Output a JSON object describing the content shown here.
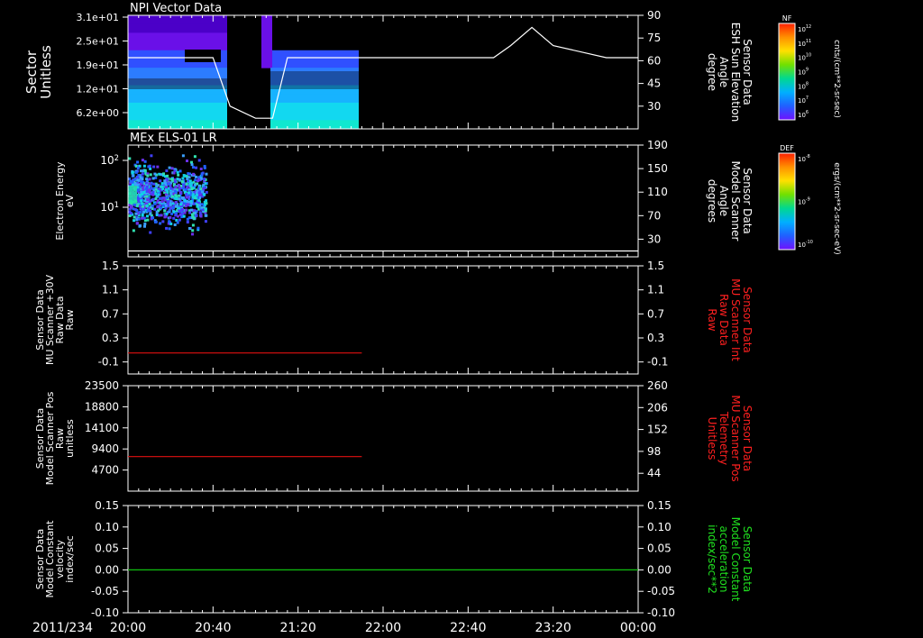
{
  "date_label": "2011/234",
  "x_ticks": [
    "20:00",
    "20:40",
    "21:20",
    "22:00",
    "22:40",
    "23:20",
    "00:00"
  ],
  "colorbars": [
    {
      "tag": "NF",
      "unit": "cnts/(cm**2-sr-sec)",
      "ticks": [
        "10^12",
        "10^11",
        "10^10",
        "10^9",
        "10^8",
        "10^7",
        "10^6"
      ]
    },
    {
      "tag": "DEF",
      "unit": "ergs/(cm**2-sr-sec-eV)",
      "ticks": [
        "10^-8",
        "10^-9",
        "10^-10"
      ]
    }
  ],
  "chart_data": [
    {
      "type": "heatmap",
      "title": "NPI Vector Data",
      "ylabel": [
        "Sector",
        "Unitless"
      ],
      "y_ticks": [
        "3.1e+01",
        "2.5e+01",
        "1.9e+01",
        "1.2e+01",
        "6.2e+00"
      ],
      "right_ylabel": [
        "Sensor Data",
        "ESH Sun Elevation",
        "Angle",
        "degree"
      ],
      "right_ylabel_color": "#ffffff",
      "right_y_ticks": [
        "90",
        "75",
        "60",
        "45",
        "30"
      ],
      "right_ylim": [
        15,
        90
      ],
      "series": [
        {
          "color": "#ffffff",
          "x_min": [
            0,
            20,
            40,
            48,
            60,
            68,
            75,
            90,
            150,
            172,
            180,
            190,
            200,
            225,
            235,
            240
          ],
          "y": [
            62,
            62,
            62,
            30,
            22,
            22,
            62,
            62,
            62,
            62,
            70,
            82,
            70,
            62,
            62,
            62
          ]
        }
      ]
    },
    {
      "type": "heatmap",
      "title": "MEx ELS-01 LR",
      "ylabel": [
        "Electron Energy",
        "eV"
      ],
      "y_ticks": [
        "10^2",
        "10^1"
      ],
      "right_ylabel": [
        "Sensor Data",
        "Model Scanner",
        "Angle",
        "degrees"
      ],
      "right_ylabel_color": "#ffffff",
      "right_y_ticks": [
        "190",
        "150",
        "110",
        "70",
        "30"
      ],
      "right_ylim": [
        0,
        190
      ],
      "series": [
        {
          "color": "#ffffff",
          "x_min": [
            0,
            240
          ],
          "y": [
            10,
            10
          ]
        }
      ]
    },
    {
      "type": "line",
      "title": "",
      "ylabel": [
        "Sensor Data",
        "MU Scanner +30V",
        "Raw Data",
        "Raw"
      ],
      "y_ticks": [
        "1.5",
        "1.1",
        "0.7",
        "0.3",
        "-0.1"
      ],
      "ylim": [
        -0.3,
        1.5
      ],
      "right_ylabel": [
        "Sensor Data",
        "MU Scanner Int",
        "Raw Data",
        "Raw"
      ],
      "right_ylabel_color": "#ff2020",
      "right_y_ticks": [
        "1.5",
        "1.1",
        "0.7",
        "0.3",
        "-0.1"
      ],
      "right_ylim": [
        -0.3,
        1.5
      ],
      "series": [
        {
          "color": "#e01010",
          "x_min": [
            0,
            110
          ],
          "y": [
            0.05,
            0.05
          ]
        }
      ]
    },
    {
      "type": "line",
      "title": "",
      "ylabel": [
        "Sensor Data",
        "Model Scanner Pos",
        "Raw",
        "unitless"
      ],
      "y_ticks": [
        "23500",
        "18800",
        "14100",
        "9400",
        "4700"
      ],
      "ylim": [
        0,
        23500
      ],
      "right_ylabel": [
        "Sensor Data",
        "MU Scanner Pos",
        "Telemetry",
        "Unitless"
      ],
      "right_ylabel_color": "#ff2020",
      "right_y_ticks": [
        "260",
        "206",
        "152",
        "98",
        "44"
      ],
      "right_ylim": [
        0,
        260
      ],
      "series": [
        {
          "color": "#e01010",
          "x_min": [
            0,
            110
          ],
          "y": [
            7700,
            7700
          ]
        }
      ]
    },
    {
      "type": "line",
      "title": "",
      "ylabel": [
        "Sensor Data",
        "Model Constant",
        "velocity",
        "index/sec"
      ],
      "y_ticks": [
        "0.15",
        "0.10",
        "0.05",
        "0.00",
        "-0.05",
        "-0.10"
      ],
      "ylim": [
        -0.1,
        0.15
      ],
      "right_ylabel": [
        "Sensor Data",
        "Model Constant",
        "acceleration",
        "index/sec**2"
      ],
      "right_ylabel_color": "#20e020",
      "right_y_ticks": [
        "0.15",
        "0.10",
        "0.05",
        "0.00",
        "-0.05",
        "-0.10"
      ],
      "right_ylim": [
        -0.1,
        0.15
      ],
      "series": [
        {
          "color": "#10c010",
          "x_min": [
            0,
            240
          ],
          "y": [
            0,
            0
          ]
        }
      ]
    }
  ]
}
